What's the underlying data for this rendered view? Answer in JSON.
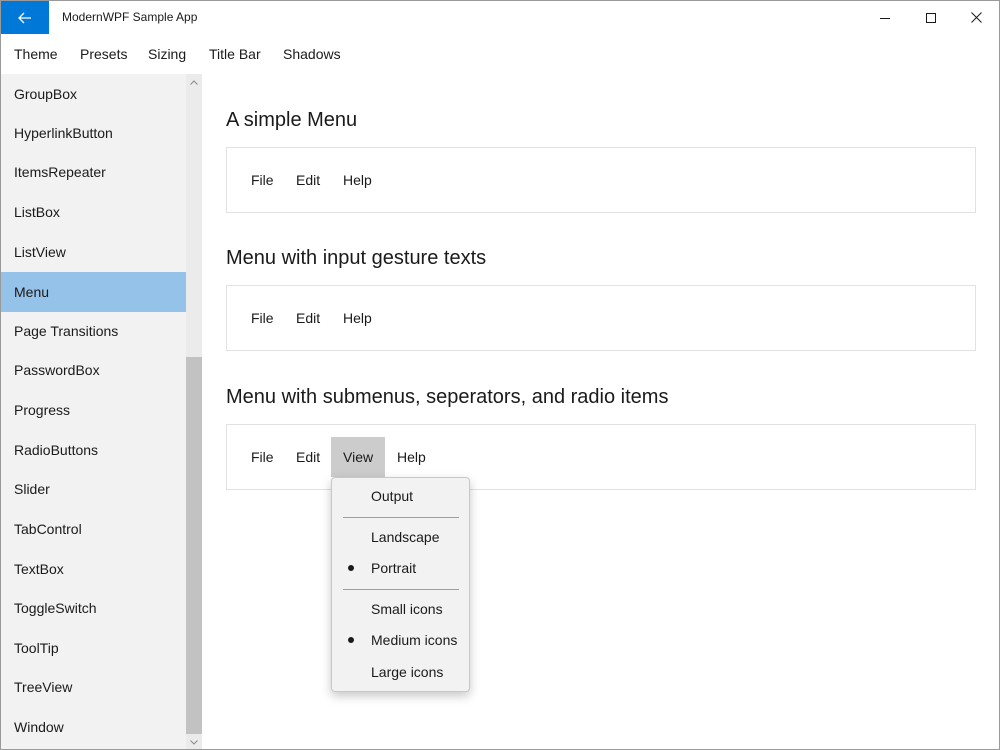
{
  "window": {
    "title": "ModernWPF Sample App",
    "accent": "#0078d7"
  },
  "topbar": {
    "items": [
      "Theme",
      "Presets",
      "Sizing",
      "Title Bar",
      "Shadows"
    ]
  },
  "sidebar": {
    "items": [
      {
        "label": "GroupBox"
      },
      {
        "label": "HyperlinkButton"
      },
      {
        "label": "ItemsRepeater"
      },
      {
        "label": "ListBox"
      },
      {
        "label": "ListView"
      },
      {
        "label": "Menu",
        "selected": true
      },
      {
        "label": "Page Transitions"
      },
      {
        "label": "PasswordBox"
      },
      {
        "label": "Progress"
      },
      {
        "label": "RadioButtons"
      },
      {
        "label": "Slider"
      },
      {
        "label": "TabControl"
      },
      {
        "label": "TextBox"
      },
      {
        "label": "ToggleSwitch"
      },
      {
        "label": "ToolTip"
      },
      {
        "label": "TreeView"
      },
      {
        "label": "Window"
      }
    ],
    "selected_color": "#95c2e8"
  },
  "sections": [
    {
      "title": "A simple Menu",
      "menu": [
        "File",
        "Edit",
        "Help"
      ]
    },
    {
      "title": "Menu with input gesture texts",
      "menu": [
        "File",
        "Edit",
        "Help"
      ]
    },
    {
      "title": "Menu with submenus, seperators, and radio items",
      "menu": [
        "File",
        "Edit",
        "View",
        "Help"
      ],
      "open_item": "View"
    }
  ],
  "dropdown": {
    "items": [
      {
        "label": "Output"
      },
      {
        "separator": true
      },
      {
        "label": "Landscape"
      },
      {
        "label": "Portrait",
        "checked": true
      },
      {
        "separator": true
      },
      {
        "label": "Small icons"
      },
      {
        "label": "Medium icons",
        "checked": true
      },
      {
        "label": "Large icons"
      }
    ]
  }
}
